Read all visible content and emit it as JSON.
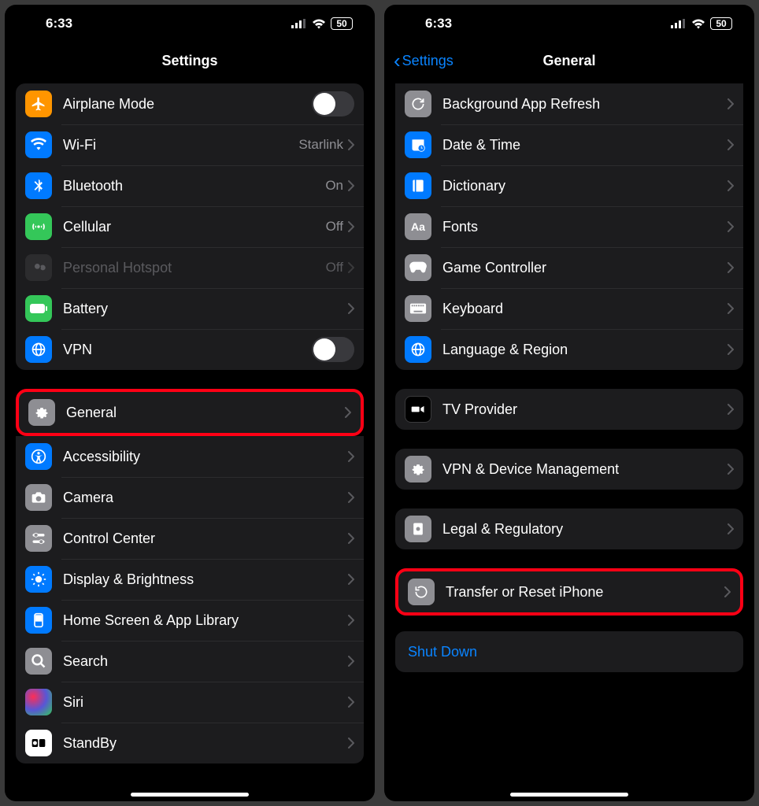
{
  "status": {
    "time": "6:33",
    "battery": "50"
  },
  "left": {
    "title": "Settings",
    "group1": [
      {
        "label": "Airplane Mode"
      },
      {
        "label": "Wi-Fi",
        "value": "Starlink"
      },
      {
        "label": "Bluetooth",
        "value": "On"
      },
      {
        "label": "Cellular",
        "value": "Off"
      },
      {
        "label": "Personal Hotspot",
        "value": "Off"
      },
      {
        "label": "Battery"
      },
      {
        "label": "VPN"
      }
    ],
    "group2": [
      {
        "label": "General"
      },
      {
        "label": "Accessibility"
      },
      {
        "label": "Camera"
      },
      {
        "label": "Control Center"
      },
      {
        "label": "Display & Brightness"
      },
      {
        "label": "Home Screen & App Library"
      },
      {
        "label": "Search"
      },
      {
        "label": "Siri"
      },
      {
        "label": "StandBy"
      }
    ]
  },
  "right": {
    "back": "Settings",
    "title": "General",
    "group1": [
      {
        "label": "Background App Refresh"
      },
      {
        "label": "Date & Time"
      },
      {
        "label": "Dictionary"
      },
      {
        "label": "Fonts"
      },
      {
        "label": "Game Controller"
      },
      {
        "label": "Keyboard"
      },
      {
        "label": "Language & Region"
      }
    ],
    "tv": {
      "label": "TV Provider"
    },
    "vpn": {
      "label": "VPN & Device Management"
    },
    "legal": {
      "label": "Legal & Regulatory"
    },
    "reset": {
      "label": "Transfer or Reset iPhone"
    },
    "shutdown": {
      "label": "Shut Down"
    }
  }
}
